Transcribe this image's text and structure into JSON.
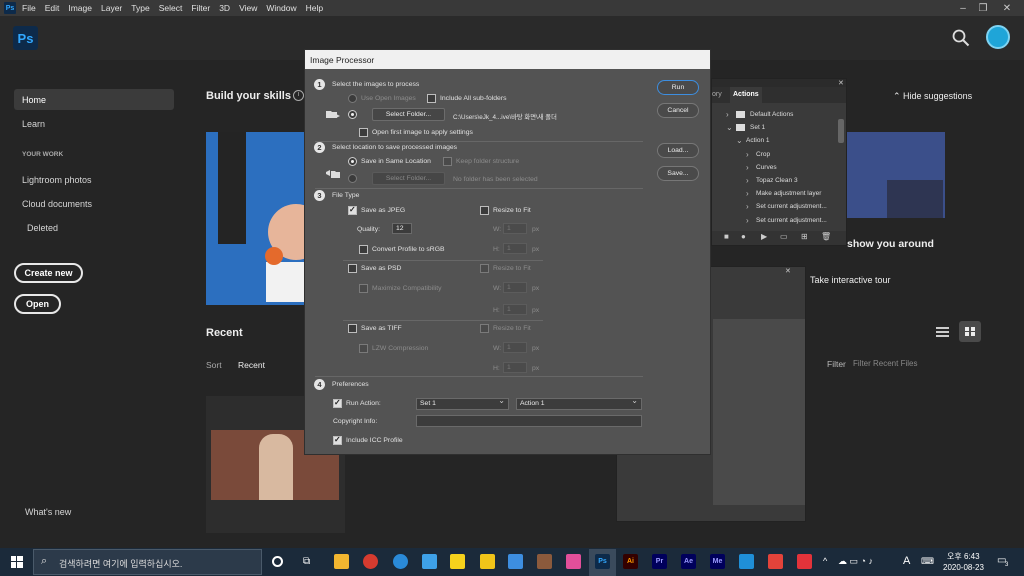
{
  "menubar": {
    "app_icon": "Ps",
    "items": [
      "File",
      "Edit",
      "Image",
      "Layer",
      "Type",
      "Select",
      "Filter",
      "3D",
      "View",
      "Window",
      "Help"
    ]
  },
  "home": {
    "logo": "Ps",
    "nav": {
      "home": "Home",
      "learn": "Learn",
      "your_work": "YOUR WORK",
      "lightroom": "Lightroom photos",
      "cloud": "Cloud documents",
      "deleted": "Deleted",
      "create_new": "Create new",
      "open": "Open",
      "whats_new": "What's new"
    },
    "build_skills": "Build your skills",
    "hide_suggestions": "Hide suggestions",
    "show_around": "show you around",
    "take_tour": "Take interactive tour",
    "recent": "Recent",
    "sort_label": "Sort",
    "sort_value": "Recent",
    "filter_label": "Filter",
    "filter_placeholder": "Filter Recent Files"
  },
  "dialog": {
    "title": "Image Processor",
    "s1": {
      "num": "1",
      "label": "Select the images to process",
      "use_open": "Use Open Images",
      "include_sub": "Include All sub-folders",
      "select_folder": "Select Folder...",
      "path": "C:\\Users\\eJk_4...ive\\바탕 화면\\새 폴더",
      "open_first": "Open first image to apply settings"
    },
    "s2": {
      "num": "2",
      "label": "Select location to save processed images",
      "same_loc": "Save in Same Location",
      "keep_struct": "Keep folder structure",
      "select_folder": "Select Folder...",
      "no_folder": "No folder has been selected"
    },
    "s3": {
      "num": "3",
      "label": "File Type",
      "jpeg": "Save as JPEG",
      "resize": "Resize to Fit",
      "quality_label": "Quality:",
      "quality_value": "12",
      "w": "W:",
      "h": "H:",
      "px": "px",
      "srgb": "Convert Profile to sRGB",
      "psd": "Save as PSD",
      "max_compat": "Maximize Compatibility",
      "tiff": "Save as TIFF",
      "lzw": "LZW Compression",
      "one": "1"
    },
    "s4": {
      "num": "4",
      "label": "Preferences",
      "run_action": "Run Action:",
      "set_value": "Set 1",
      "action_value": "Action 1",
      "copyright": "Copyright Info:",
      "icc": "Include ICC Profile"
    },
    "buttons": {
      "run": "Run",
      "cancel": "Cancel",
      "load": "Load...",
      "save": "Save..."
    }
  },
  "actions_panel": {
    "tab_history": "ory",
    "tab_actions": "Actions",
    "items": [
      {
        "label": "Default Actions",
        "level": 0,
        "kind": "folder"
      },
      {
        "label": "Set 1",
        "level": 0,
        "kind": "folder"
      },
      {
        "label": "Action 1",
        "level": 1,
        "kind": "action"
      },
      {
        "label": "Crop",
        "level": 2,
        "kind": "step"
      },
      {
        "label": "Curves",
        "level": 2,
        "kind": "step"
      },
      {
        "label": "Topaz Clean 3",
        "level": 2,
        "kind": "step"
      },
      {
        "label": "Make adjustment layer",
        "level": 2,
        "kind": "step"
      },
      {
        "label": "Set current adjustment...",
        "level": 2,
        "kind": "step"
      },
      {
        "label": "Set current adjustment...",
        "level": 2,
        "kind": "step"
      }
    ]
  },
  "taskbar": {
    "search_placeholder": "검색하려면 여기에 입력하십시오.",
    "time": "오후 6:43",
    "date": "2020-08-23",
    "ime": "A",
    "notif_count": "3"
  },
  "colors": {
    "accent": "#31a8ff",
    "dialog_bg": "#535353",
    "taskbar": "#1b2a3a"
  }
}
